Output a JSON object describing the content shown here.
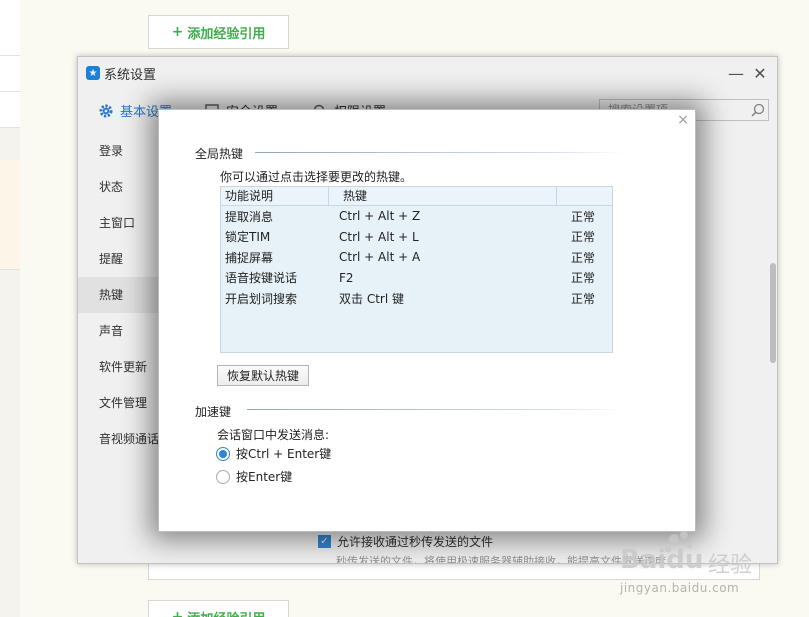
{
  "page": {
    "add_exp_label": "添加经验引用",
    "add_exp_plus": "+"
  },
  "settings_window": {
    "title": "系统设置",
    "app_icon_glyph": "★",
    "minimize_glyph": "—",
    "close_glyph": "✕",
    "tabs": [
      {
        "label": "基本设置",
        "icon": "gear-icon"
      },
      {
        "label": "安全设置",
        "icon": "shield-icon"
      },
      {
        "label": "权限设置",
        "icon": "search-icon"
      }
    ],
    "search_placeholder": "搜索设置项",
    "sidebar": [
      "登录",
      "状态",
      "主窗口",
      "提醒",
      "热键",
      "声音",
      "软件更新",
      "文件管理",
      "音视频通话"
    ],
    "active_sidebar": "热键",
    "bottom_check_label": "允许接收通过秒传发送的文件",
    "bottom_note": "秒传发送的文件，将使用极速服务器辅助接收，能提高文件发送速度",
    "accent_color": "#2b7fd6"
  },
  "hotkey_dialog": {
    "close_glyph": "×",
    "section_global": "全局热键",
    "desc": "你可以通过点击选择要更改的热键。",
    "columns": [
      "功能说明",
      "热键",
      ""
    ],
    "rows": [
      {
        "func": "提取消息",
        "key": "Ctrl + Alt + Z",
        "status": "正常"
      },
      {
        "func": "锁定TIM",
        "key": "Ctrl + Alt + L",
        "status": "正常"
      },
      {
        "func": "捕捉屏幕",
        "key": "Ctrl + Alt + A",
        "status": "正常"
      },
      {
        "func": "语音按键说话",
        "key": "F2",
        "status": "正常"
      },
      {
        "func": "开启划词搜索",
        "key": "双击 Ctrl 键",
        "status": "正常"
      }
    ],
    "restore_label": "恢复默认热键",
    "section_accel": "加速键",
    "send_label": "会话窗口中发送消息:",
    "options": [
      {
        "label": "按Ctrl + Enter键",
        "selected": true
      },
      {
        "label": "按Enter键",
        "selected": false
      }
    ]
  },
  "watermark": {
    "logo": "Baidu",
    "logo_cn": "经验",
    "url": "jingyan.baidu.com"
  }
}
